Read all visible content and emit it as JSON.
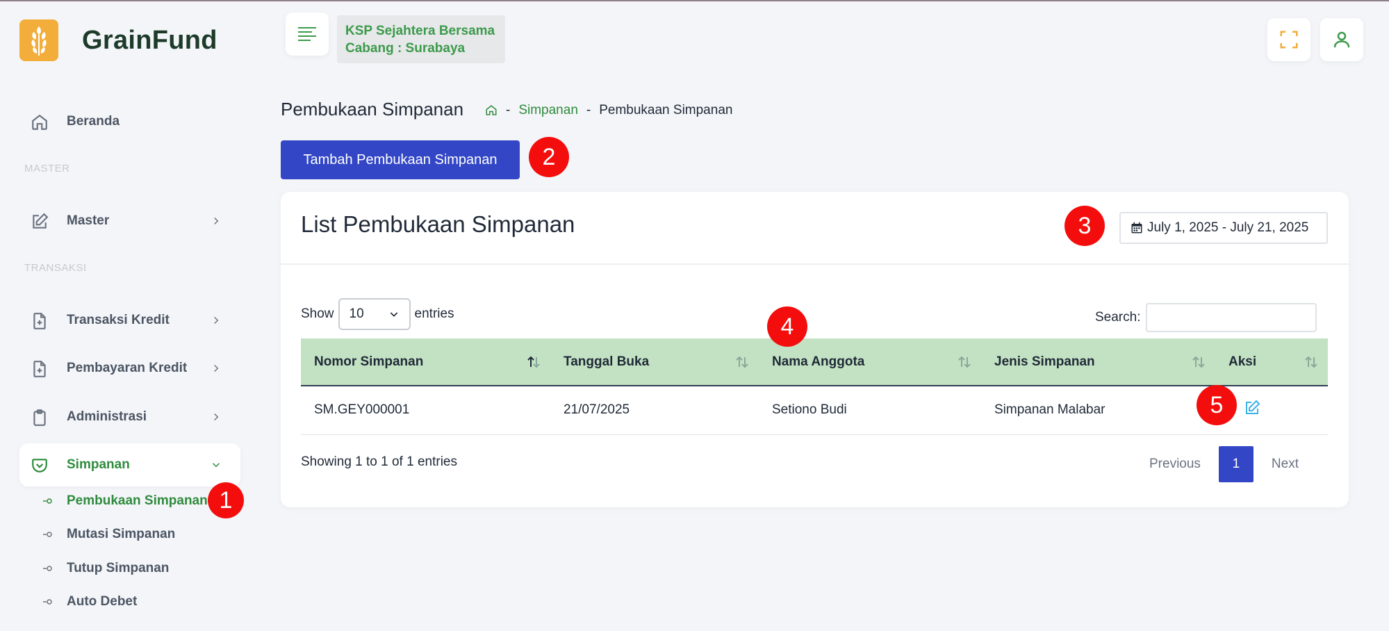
{
  "app": {
    "brand_name": "GrainFund",
    "accent_color": "#2e8b3d",
    "primary_color": "#3347c6"
  },
  "topbar": {
    "org_name": "KSP Sejahtera Bersama",
    "branch": "Cabang : Surabaya",
    "menu_icon": "menu-lines-icon",
    "fullscreen_icon": "fullscreen-icon",
    "user_icon": "user-icon"
  },
  "sidebar": {
    "sections": {
      "master": "MASTER",
      "transaksi": "TRANSAKSI"
    },
    "items": [
      {
        "label": "Beranda",
        "icon": "home-icon"
      },
      {
        "label": "Master",
        "icon": "edit-icon"
      },
      {
        "label": "Transaksi Kredit",
        "icon": "file-plus-icon"
      },
      {
        "label": "Pembayaran Kredit",
        "icon": "file-plus-icon"
      },
      {
        "label": "Administrasi",
        "icon": "clipboard-icon"
      },
      {
        "label": "Simpanan",
        "icon": "pocket-icon"
      }
    ],
    "sub_items": [
      {
        "label": "Pembukaan Simpanan"
      },
      {
        "label": "Mutasi Simpanan"
      },
      {
        "label": "Tutup Simpanan"
      },
      {
        "label": "Auto Debet"
      }
    ]
  },
  "page": {
    "title": "Pembukaan Simpanan",
    "breadcrumb": {
      "sep": "-",
      "link": "Simpanan",
      "current": "Pembukaan Simpanan"
    },
    "add_button": "Tambah Pembukaan Simpanan"
  },
  "card": {
    "title": "List Pembukaan Simpanan",
    "date_range": "July 1, 2025 - July 21, 2025",
    "show_label": "Show",
    "entries_value": "10",
    "entries_label": "entries",
    "search_label": "Search:",
    "columns": [
      "Nomor Simpanan",
      "Tanggal Buka",
      "Nama Anggota",
      "Jenis Simpanan",
      "Aksi"
    ],
    "rows": [
      {
        "nomor": "SM.GEY000001",
        "tanggal": "21/07/2025",
        "nama": "Setiono Budi",
        "jenis": "Simpanan Malabar",
        "aksi_icon": "edit-icon"
      }
    ],
    "info": "Showing 1 to 1 of 1 entries",
    "pagination": {
      "previous": "Previous",
      "page": "1",
      "next": "Next"
    }
  },
  "annotations": [
    "1",
    "2",
    "3",
    "4",
    "5"
  ]
}
